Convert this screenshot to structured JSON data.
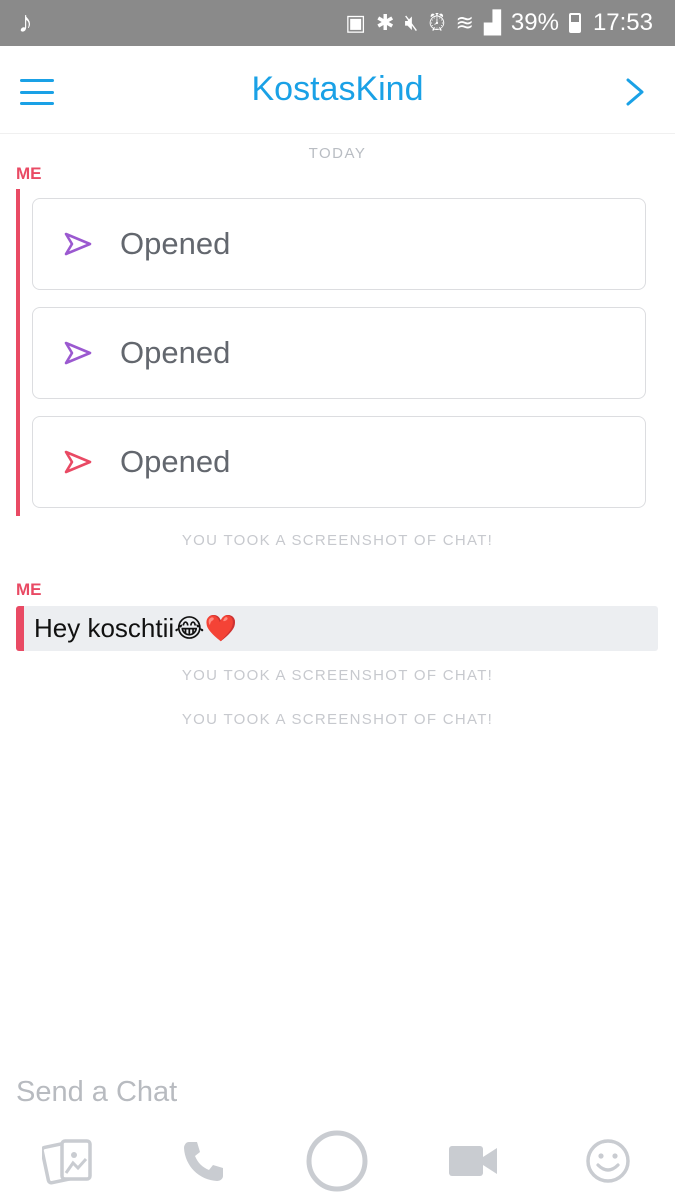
{
  "status_bar": {
    "time": "17:53",
    "battery": "39%",
    "icons": [
      "music-note-icon",
      "battery-saver-icon",
      "bluetooth-icon",
      "mute-icon",
      "alarm-icon",
      "wifi-icon",
      "signal-icon",
      "battery-icon"
    ]
  },
  "header": {
    "title": "KostasKind"
  },
  "chat": {
    "day_label": "TODAY",
    "groups": [
      {
        "sender": "ME",
        "snaps": [
          {
            "label": "Opened",
            "color": "#9b59d0"
          },
          {
            "label": "Opened",
            "color": "#9b59d0"
          },
          {
            "label": "Opened",
            "color": "#e94a64"
          }
        ]
      },
      {
        "sender": "ME",
        "message": "Hey koschtii😂❤️"
      }
    ],
    "notices": [
      "YOU TOOK A SCREENSHOT OF CHAT!",
      "YOU TOOK A SCREENSHOT OF CHAT!",
      "YOU TOOK A SCREENSHOT OF CHAT!"
    ]
  },
  "composer": {
    "placeholder": "Send a Chat"
  },
  "colors": {
    "accent_blue": "#1aa1e6",
    "me_red": "#e94a64",
    "snap_purple": "#9b59d0"
  }
}
